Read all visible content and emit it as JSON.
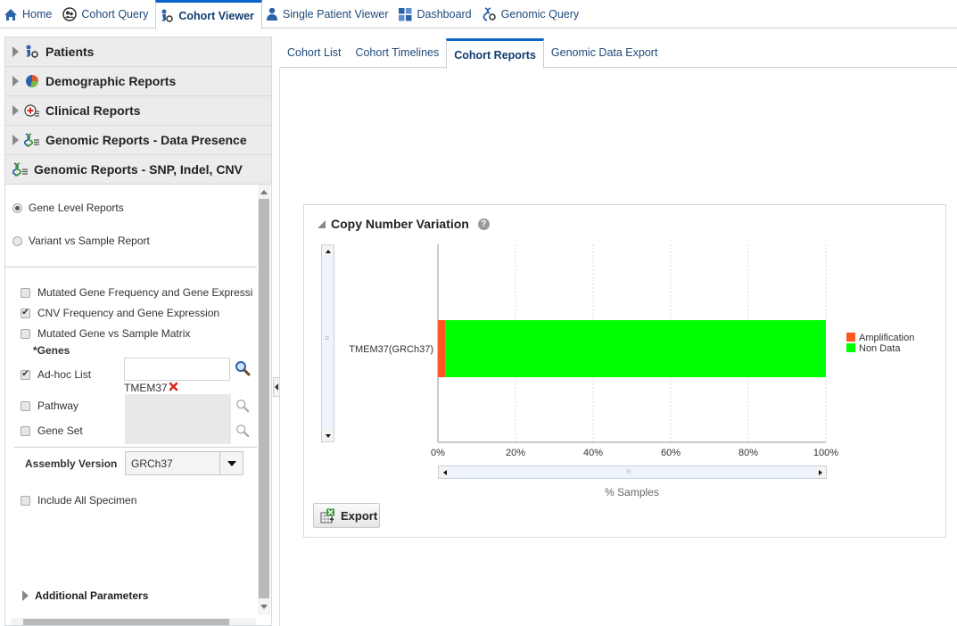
{
  "topnav": {
    "items": [
      {
        "label": "Home",
        "icon": "home-icon"
      },
      {
        "label": "Cohort Query",
        "icon": "cohort-query-icon"
      },
      {
        "label": "Cohort Viewer",
        "icon": "cohort-viewer-icon",
        "active": true
      },
      {
        "label": "Single Patient Viewer",
        "icon": "patient-icon"
      },
      {
        "label": "Dashboard",
        "icon": "dashboard-icon"
      },
      {
        "label": "Genomic Query",
        "icon": "genomic-query-icon"
      }
    ]
  },
  "sidebar": {
    "accordion": [
      {
        "label": "Patients",
        "icon": "patients-icon",
        "expanded": false
      },
      {
        "label": "Demographic Reports",
        "icon": "pie-chart-icon",
        "expanded": false
      },
      {
        "label": "Clinical Reports",
        "icon": "clinical-icon",
        "expanded": false
      },
      {
        "label": "Genomic Reports - Data Presence",
        "icon": "dna-icon",
        "expanded": false
      },
      {
        "label": "Genomic Reports - SNP, Indel, CNV",
        "icon": "dna-icon",
        "expanded": true
      }
    ],
    "report_type": {
      "options": [
        {
          "label": "Gene Level Reports",
          "selected": true
        },
        {
          "label": "Variant vs Sample Report",
          "selected": false
        }
      ]
    },
    "report_checkboxes": [
      {
        "label": "Mutated Gene Frequency and Gene Expressi",
        "checked": false
      },
      {
        "label": "CNV Frequency and Gene Expression",
        "checked": true
      },
      {
        "label": "Mutated Gene vs Sample Matrix",
        "checked": false
      }
    ],
    "genes": {
      "label": "*Genes",
      "adhoc": {
        "label": "Ad-hoc List",
        "checked": true,
        "value": "",
        "tags": [
          "TMEM37"
        ]
      },
      "pathway": {
        "label": "Pathway",
        "checked": false
      },
      "gene_set": {
        "label": "Gene Set",
        "checked": false
      }
    },
    "assembly": {
      "label": "Assembly Version",
      "value": "GRCh37"
    },
    "include_all": {
      "label": "Include All Specimen",
      "checked": false
    },
    "additional": {
      "label": "Additional Parameters"
    }
  },
  "subtabs": [
    {
      "label": "Cohort List"
    },
    {
      "label": "Cohort Timelines"
    },
    {
      "label": "Cohort Reports",
      "active": true
    },
    {
      "label": "Genomic Data Export"
    }
  ],
  "report": {
    "title": "Copy Number Variation",
    "help_symbol": "?",
    "export_label": "Export"
  },
  "chart_data": {
    "type": "bar",
    "orientation": "horizontal",
    "stacked": true,
    "categories": [
      "TMEM37(GRCh37)"
    ],
    "series": [
      {
        "name": "Amplification",
        "values": [
          2
        ],
        "color": "#ff5722"
      },
      {
        "name": "Non Data",
        "values": [
          98
        ],
        "color": "#00ff00"
      }
    ],
    "xlabel": "% Samples",
    "ylabel": "",
    "xlim": [
      0,
      100
    ],
    "xticks": [
      "0%",
      "20%",
      "40%",
      "60%",
      "80%",
      "100%"
    ],
    "grid": true,
    "legend": "right"
  }
}
